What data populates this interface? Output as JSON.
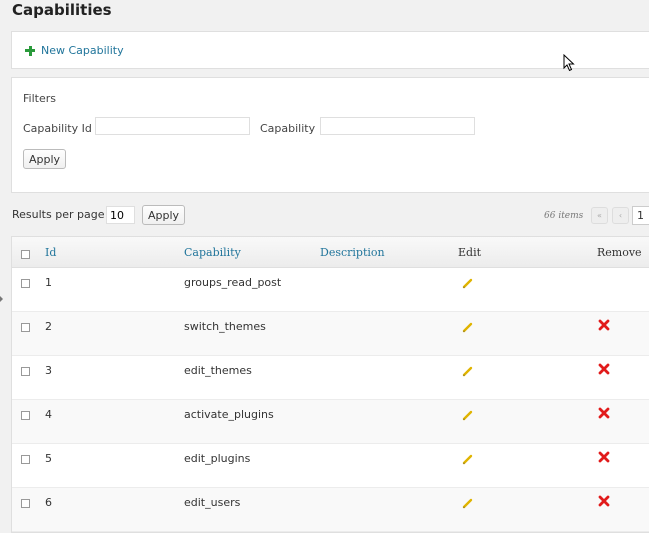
{
  "page": {
    "title": "Capabilities"
  },
  "actions": {
    "new_capability": "New Capability"
  },
  "filters": {
    "heading": "Filters",
    "capability_id_label": "Capability Id",
    "capability_id_value": "",
    "capability_label": "Capability",
    "capability_value": "",
    "apply": "Apply"
  },
  "results": {
    "label": "Results per page",
    "value": "10",
    "apply": "Apply",
    "items_count": "66 items",
    "first_page": "«",
    "prev_page": "‹",
    "current_page": "1"
  },
  "table": {
    "columns": {
      "id": "Id",
      "capability": "Capability",
      "description": "Description",
      "edit": "Edit",
      "remove": "Remove"
    },
    "rows": [
      {
        "id": "1",
        "capability": "groups_read_post",
        "description": "",
        "removable": false
      },
      {
        "id": "2",
        "capability": "switch_themes",
        "description": "",
        "removable": true
      },
      {
        "id": "3",
        "capability": "edit_themes",
        "description": "",
        "removable": true
      },
      {
        "id": "4",
        "capability": "activate_plugins",
        "description": "",
        "removable": true
      },
      {
        "id": "5",
        "capability": "edit_plugins",
        "description": "",
        "removable": true
      },
      {
        "id": "6",
        "capability": "edit_users",
        "description": "",
        "removable": true
      }
    ]
  },
  "icons": {
    "new": "plus-icon",
    "edit": "pencil-icon",
    "remove": "x-icon",
    "cursor": "mouse-cursor-icon"
  },
  "colors": {
    "link": "#21759b",
    "plus": "#2a9a3b",
    "remove": "#e11b1b",
    "pencil": "#e0b400"
  }
}
